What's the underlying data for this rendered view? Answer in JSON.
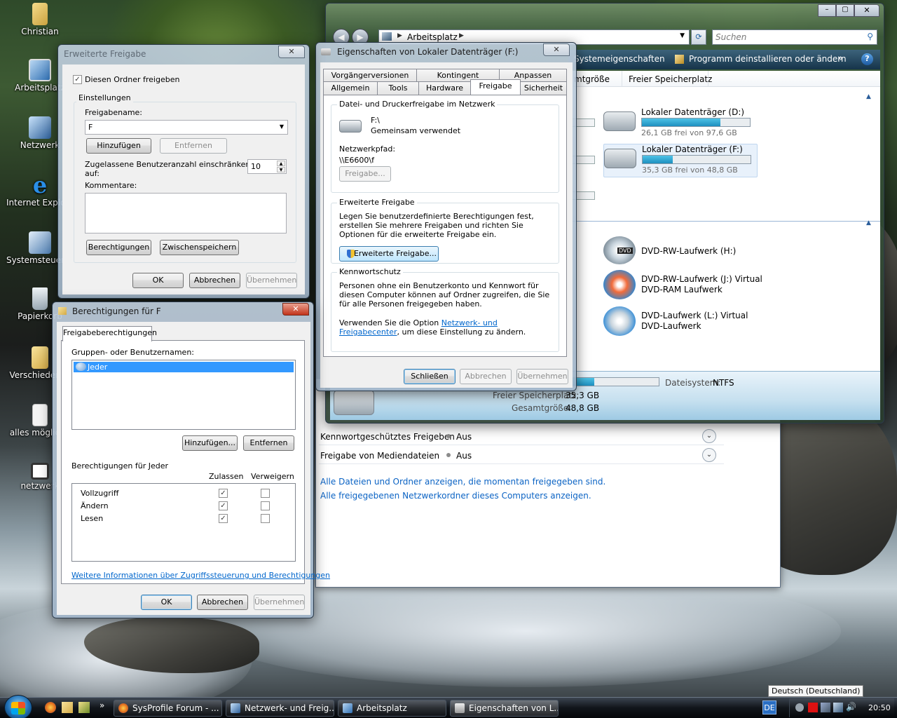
{
  "desktop": {
    "icons": [
      {
        "label": "Christian",
        "icon": "folder-user-icon"
      },
      {
        "label": "Arbeitsplatz",
        "icon": "computer-icon"
      },
      {
        "label": "Netzwerk",
        "icon": "network-icon"
      },
      {
        "label": "Internet Explorer",
        "icon": "ie-icon"
      },
      {
        "label": "Systemsteuerung",
        "icon": "control-panel-icon"
      },
      {
        "label": "Papierkorb",
        "icon": "recycle-bin-icon"
      },
      {
        "label": "Verschiedenes",
        "icon": "folder-icon"
      },
      {
        "label": "alles mögliche",
        "icon": "document-icon"
      },
      {
        "label": "netzwerk",
        "icon": "screenshot-icon"
      }
    ]
  },
  "explorer": {
    "address": "Arbeitsplatz",
    "search_placeholder": "Suchen",
    "toolbar": {
      "system_props": "Systemeigenschaften",
      "uninstall": "Programm deinstallieren oder ändern",
      "more": "»"
    },
    "columns": {
      "total_size_partial": "mtgröße",
      "free_space": "Freier Speicherplatz"
    },
    "drives": [
      {
        "name": "Lokaler Datenträger (D:)",
        "free": "26,1 GB frei von 97,6 GB",
        "used_fraction": 0.73
      },
      {
        "name": "Lokaler Datenträger (F:)",
        "free": "35,3 GB frei von 48,8 GB",
        "used_fraction": 0.28
      }
    ],
    "removable": [
      {
        "line1": "DVD-RW-Laufwerk (H:)",
        "line2": "",
        "badge": "DVD"
      },
      {
        "line1": "DVD-RW-Laufwerk (J:) Virtual",
        "line2": "DVD-RAM Laufwerk"
      },
      {
        "line1": "DVD-Laufwerk (L:) Virtual",
        "line2": "DVD-Laufwerk"
      }
    ],
    "details": {
      "filesystem_label": "Dateisystem:",
      "filesystem_value": "NTFS",
      "free_label": "Freier Speicherplatz:",
      "free_value": "35,3 GB",
      "total_label": "Gesamtgröße:",
      "total_value": "48,8 GB"
    }
  },
  "network_center": {
    "rows": [
      {
        "label": "Kennwortgeschütztes Freigeben",
        "value": "Aus"
      },
      {
        "label": "Freigabe von Mediendateien",
        "value": "Aus"
      }
    ],
    "links": [
      "Alle Dateien und Ordner anzeigen, die momentan freigegeben sind.",
      "Alle freigegebenen Netzwerkordner dieses Computers anzeigen."
    ]
  },
  "properties": {
    "title": "Eigenschaften von Lokaler Datenträger (F:)",
    "tabs_row1": [
      "Vorgängerversionen",
      "Kontingent",
      "Anpassen"
    ],
    "tabs_row2": [
      "Allgemein",
      "Tools",
      "Hardware",
      "Freigabe",
      "Sicherheit"
    ],
    "share_group": "Datei- und Druckerfreigabe im Netzwerk",
    "drive_path": "F:\\",
    "shared_status": "Gemeinsam verwendet",
    "netpath_label": "Netzwerkpfad:",
    "netpath_value": "\\\\E6600\\f",
    "share_button": "Freigabe...",
    "adv_group": "Erweiterte Freigabe",
    "adv_text": "Legen Sie benutzerdefinierte Berechtigungen fest, erstellen Sie mehrere Freigaben und richten Sie Optionen für die erweiterte Freigabe ein.",
    "adv_button": "Erweiterte Freigabe...",
    "pw_group": "Kennwortschutz",
    "pw_text": "Personen ohne ein Benutzerkonto und Kennwort für diesen Computer können auf Ordner zugreifen, die Sie für alle Personen freigegeben haben.",
    "pw_text2_pre": "Verwenden Sie die Option ",
    "pw_link": "Netzwerk- und Freigabecenter",
    "pw_text2_post": ", um diese Einstellung zu ändern.",
    "close": "Schließen",
    "cancel": "Abbrechen",
    "apply": "Übernehmen"
  },
  "advanced_share": {
    "title": "Erweiterte Freigabe",
    "share_checkbox": "Diesen Ordner freigeben",
    "settings_group": "Einstellungen",
    "share_name_label": "Freigabename:",
    "share_name_value": "F",
    "add": "Hinzufügen",
    "remove": "Entfernen",
    "limit_label_1": "Zugelassene Benutzeranzahl einschränken",
    "limit_label_2": "auf:",
    "limit_value": "10",
    "comments_label": "Kommentare:",
    "permissions": "Berechtigungen",
    "caching": "Zwischenspeichern",
    "ok": "OK",
    "cancel": "Abbrechen",
    "apply": "Übernehmen"
  },
  "permissions": {
    "title": "Berechtigungen für F",
    "tab": "Freigabeberechtigungen",
    "users_label": "Gruppen- oder Benutzernamen:",
    "users": [
      "Jeder"
    ],
    "add": "Hinzufügen...",
    "remove": "Entfernen",
    "perm_label": "Berechtigungen für Jeder",
    "allow": "Zulassen",
    "deny": "Verweigern",
    "rows": [
      {
        "name": "Vollzugriff",
        "allow": true,
        "deny": false
      },
      {
        "name": "Ändern",
        "allow": true,
        "deny": false
      },
      {
        "name": "Lesen",
        "allow": true,
        "deny": false
      }
    ],
    "info_link": "Weitere Informationen über Zugriffssteuerung und Berechtigungen",
    "ok": "OK",
    "cancel": "Abbrechen",
    "apply": "Übernehmen"
  },
  "taskbar": {
    "quicklaunch_more": "»",
    "tasks": [
      {
        "label": "SysProfile Forum - ...",
        "icon": "firefox-icon"
      },
      {
        "label": "Netzwerk- und Freig...",
        "icon": "network-center-icon"
      },
      {
        "label": "Arbeitsplatz",
        "icon": "computer-icon"
      },
      {
        "label": "Eigenschaften von L...",
        "icon": "drive-properties-icon"
      }
    ],
    "lang": "DE",
    "lang_tooltip": "Deutsch (Deutschland)",
    "clock": "20:50"
  }
}
